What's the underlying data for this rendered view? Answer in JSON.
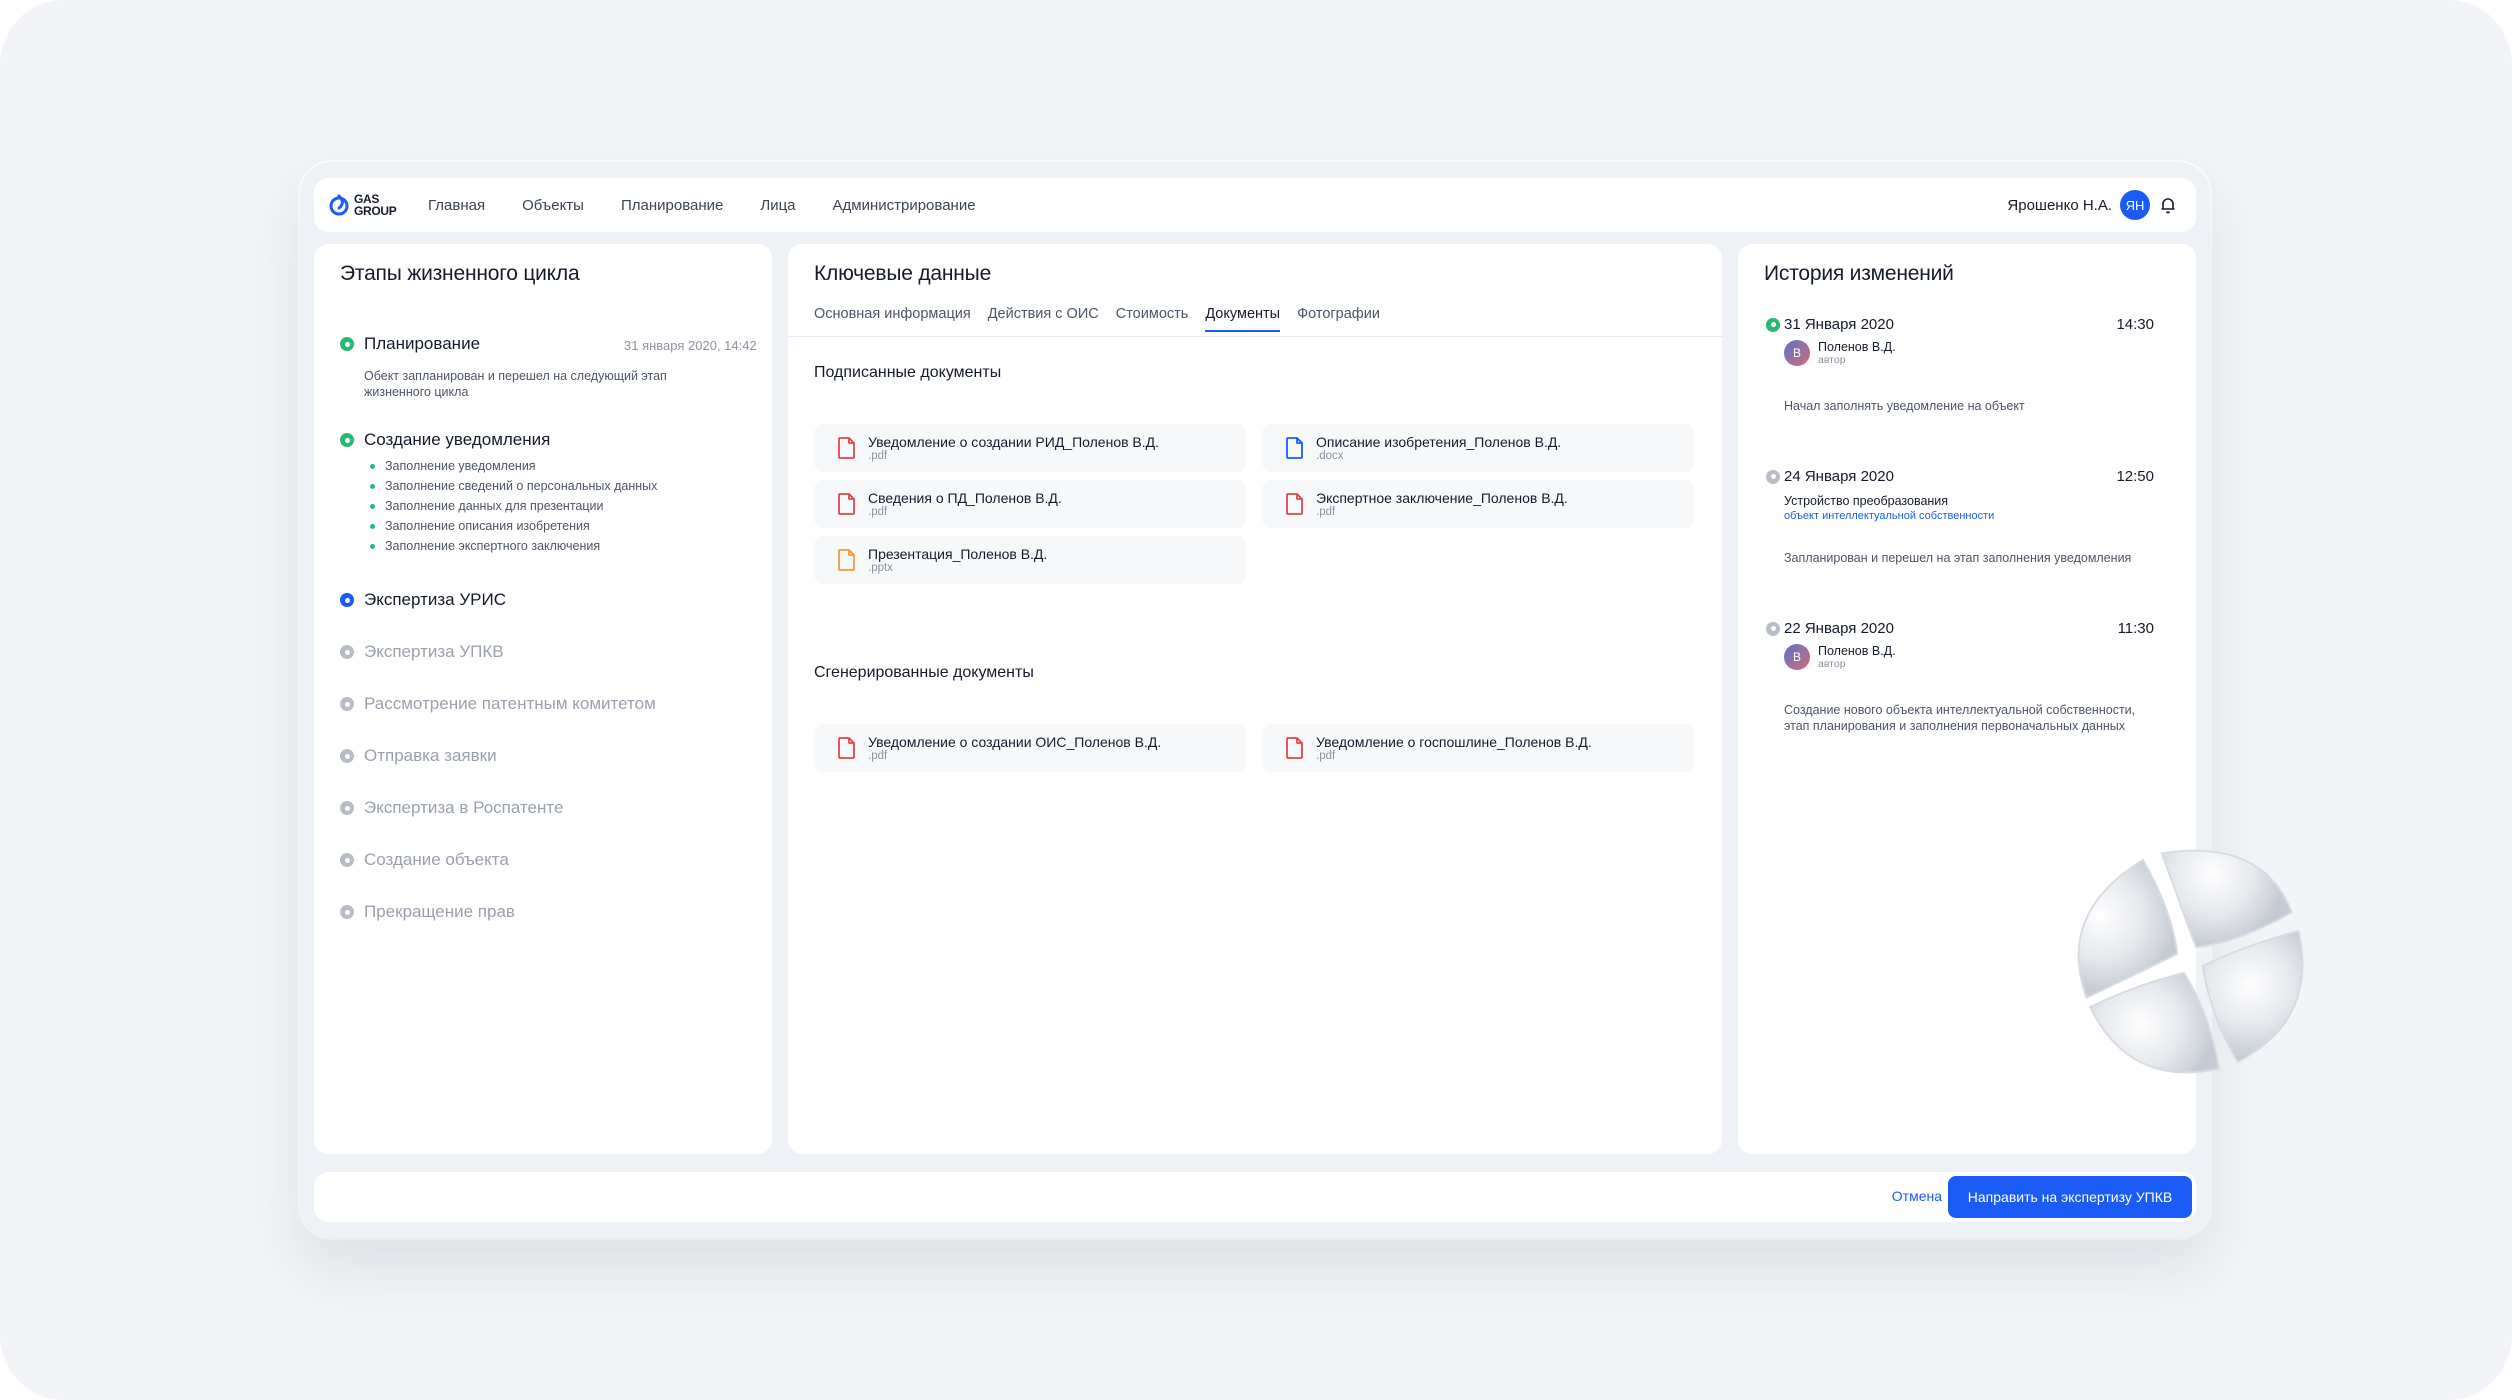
{
  "brand": {
    "logo_text_line1": "GAS",
    "logo_text_line2": "GROUP"
  },
  "nav": [
    "Главная",
    "Объекты",
    "Планирование",
    "Лица",
    "Администрирование"
  ],
  "user": {
    "name": "Ярошенко Н.А.",
    "initials": "ЯН"
  },
  "lifecycle": {
    "title": "Этапы жизненного цикла",
    "stages": [
      {
        "title": "Планирование",
        "status": "done",
        "date": "31 января 2020, 14:42",
        "desc": "Обект запланирован и перешел на следующий этап жизненного цикла"
      },
      {
        "title": "Создание уведомления",
        "status": "done",
        "items": [
          "Заполнение уведомления",
          "Заполнение сведений о персональных данных",
          "Заполнение данных для презентации",
          "Заполнение описания изобретения",
          "Заполнение экспертного заключения"
        ]
      },
      {
        "title": "Экспертиза УРИС",
        "status": "current"
      },
      {
        "title": "Экспертиза УПКВ",
        "status": "pending"
      },
      {
        "title": "Рассмотрение патентным комитетом",
        "status": "pending"
      },
      {
        "title": "Отправка заявки",
        "status": "pending"
      },
      {
        "title": "Экспертиза в Роспатенте",
        "status": "pending"
      },
      {
        "title": "Создание объекта",
        "status": "pending"
      },
      {
        "title": "Прекращение прав",
        "status": "pending"
      }
    ]
  },
  "key_data": {
    "title": "Ключевые данные",
    "tabs": [
      "Основная информация",
      "Действия с ОИС",
      "Стоимость",
      "Документы",
      "Фотографии"
    ],
    "active_tab": "Документы",
    "signed_title": "Подписанные документы",
    "signed_docs": [
      {
        "name": "Уведомление о создании РИД_Поленов В.Д.",
        "ext": ".pdf",
        "color": "#e0474c"
      },
      {
        "name": "Описание изобретения_Поленов В.Д.",
        "ext": ".docx",
        "color": "#1a5cf5"
      },
      {
        "name": "Сведения о ПД_Поленов В.Д.",
        "ext": ".pdf",
        "color": "#e0474c"
      },
      {
        "name": "Экспертное заключение_Поленов В.Д.",
        "ext": ".pdf",
        "color": "#e0474c"
      },
      {
        "name": "Презентация_Поленов В.Д.",
        "ext": ".pptx",
        "color": "#f29a38"
      }
    ],
    "generated_title": "Сгенерированные документы",
    "generated_docs": [
      {
        "name": "Уведомление о создании ОИС_Поленов В.Д.",
        "ext": ".pdf",
        "color": "#e0474c"
      },
      {
        "name": "Уведомление о госпошлине_Поленов В.Д.",
        "ext": ".pdf",
        "color": "#e0474c"
      }
    ]
  },
  "history": {
    "title": "История изменений",
    "entries": [
      {
        "date": "31 Января 2020",
        "time": "14:30",
        "status": "green",
        "author": "Поленов В.Д.",
        "author_initial": "В",
        "role": "автор",
        "note": "Начал заполнять уведомление на объект"
      },
      {
        "date": "24 Января 2020",
        "time": "12:50",
        "status": "gray",
        "sub_title": "Устройство преобразования",
        "sub_link": "объект интеллектуальной собственности",
        "note": "Запланирован и перешел на этап заполнения уведомления"
      },
      {
        "date": "22 Января 2020",
        "time": "11:30",
        "status": "gray",
        "author": "Поленов В.Д.",
        "author_initial": "В",
        "role": "автор",
        "note": "Создание нового объекта интеллектуальной собственности, этап планирования и заполнения первоначальных данных"
      }
    ]
  },
  "footer": {
    "cancel": "Отмена",
    "submit": "Направить на экспертизу УПКВ"
  },
  "colors": {
    "primary": "#1a5cf5",
    "done": "#2bb673",
    "pending": "#b7bcc6",
    "pdf": "#e0474c",
    "docx": "#1a5cf5",
    "pptx": "#f29a38"
  }
}
